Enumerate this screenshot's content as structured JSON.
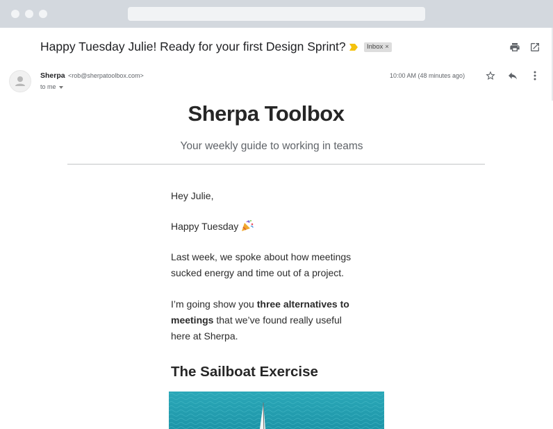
{
  "email": {
    "subject": "Happy Tuesday Julie! Ready for your first Design Sprint?",
    "label_chip": "Inbox",
    "label_remove": "×",
    "sender_name": "Sherpa",
    "sender_email": "<rob@sherpatoolbox.com>",
    "recipient": "to me",
    "timestamp": "10:00 AM (48 minutes ago)"
  },
  "newsletter": {
    "title": "Sherpa Toolbox",
    "subtitle": "Your weekly guide to working in teams",
    "greeting": "Hey Julie,",
    "happy": "Happy Tuesday",
    "para1_line1": "Last week, we spoke about how meetings",
    "para1_line2": "sucked energy and time out of a project.",
    "para2_line1_a": "I’m going show you ",
    "para2_line1_b": "three alternatives to",
    "para2_line2_a": "meetings",
    "para2_line2_b": " that we’ve found really useful",
    "para2_line3": "here at Sherpa.",
    "section_heading": "The Sailboat Exercise"
  },
  "icons": {
    "importance": "importance-marker-icon",
    "print": "print-icon",
    "popout": "open-in-new-window-icon",
    "star": "star-icon",
    "reply": "reply-icon",
    "more": "more-vertical-icon",
    "emoji": "party-popper-icon"
  },
  "colors": {
    "importance": "#f4c20d",
    "sea": "#2aa6b6"
  }
}
